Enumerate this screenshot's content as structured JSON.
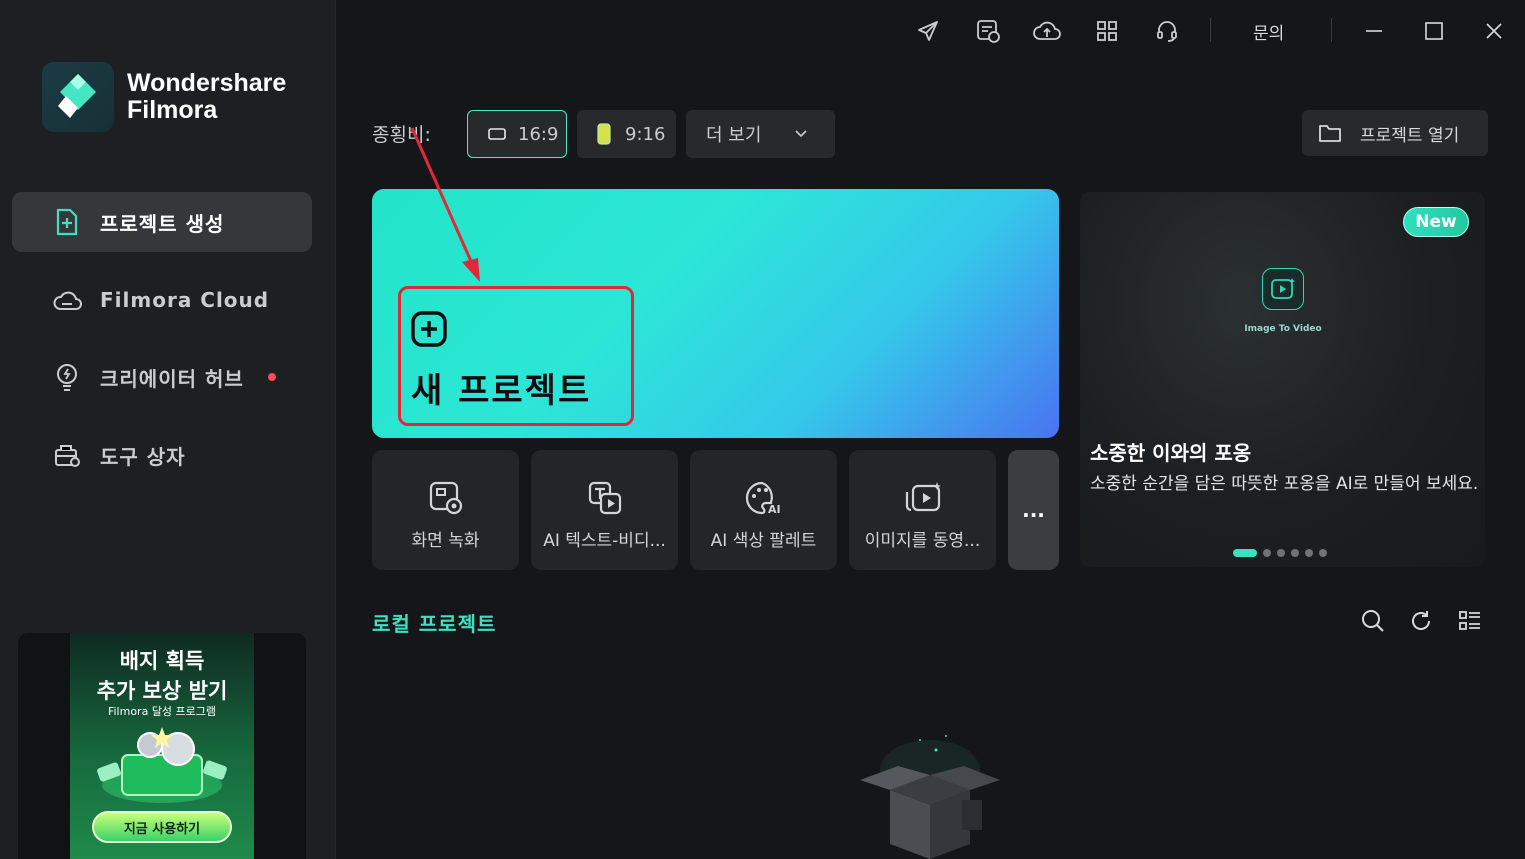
{
  "app": {
    "logo_line1": "Wondershare",
    "logo_line2": "Filmora",
    "accent_color": "#3fe0c0",
    "annotation_color": "#e02838"
  },
  "sidebar": {
    "items": [
      {
        "label": "프로젝트 생성",
        "icon": "new-project-icon",
        "active": true
      },
      {
        "label": "Filmora Cloud",
        "icon": "cloud-icon"
      },
      {
        "label": "크리에이터 허브",
        "icon": "lightbulb-icon",
        "has_dot": true
      },
      {
        "label": "도구 상자",
        "icon": "toolbox-icon"
      }
    ],
    "promo": {
      "line1": "배지 획득",
      "line2": "추가 보상 받기",
      "line3": "Filmora 달성 프로그램",
      "button": "지금 사용하기"
    }
  },
  "topbar": {
    "icons": [
      "send-icon",
      "calendar-icon",
      "cloud-upload-icon",
      "apps-grid-icon",
      "headset-icon"
    ],
    "inquiry_label": "문의"
  },
  "aspect": {
    "label": "종횡비:",
    "options": [
      "16:9",
      "9:16"
    ],
    "selected": "16:9",
    "more_label": "더 보기"
  },
  "open_project_label": "프로젝트 열기",
  "hero": {
    "label": "새 프로젝트"
  },
  "tools": [
    {
      "label": "화면 녹화",
      "icon": "screen-record-icon"
    },
    {
      "label": "AI 텍스트-비디...",
      "icon": "text-to-video-icon"
    },
    {
      "label": "AI 색상 팔레트",
      "icon": "ai-palette-icon"
    },
    {
      "label": "이미지를 동영...",
      "icon": "image-to-video-icon"
    }
  ],
  "more_tools_label": "...",
  "feature": {
    "badge": "New",
    "caption": "Image To Video",
    "title": "소중한 이와의 포옹",
    "description": "소중한 순간을 담은 따뜻한 포옹을 AI로 만들어 보세요.",
    "slide_count": 6,
    "active_slide": 1
  },
  "local_projects": {
    "title": "로컬 프로젝트",
    "icons": [
      "search-icon",
      "refresh-icon",
      "list-view-icon"
    ]
  }
}
